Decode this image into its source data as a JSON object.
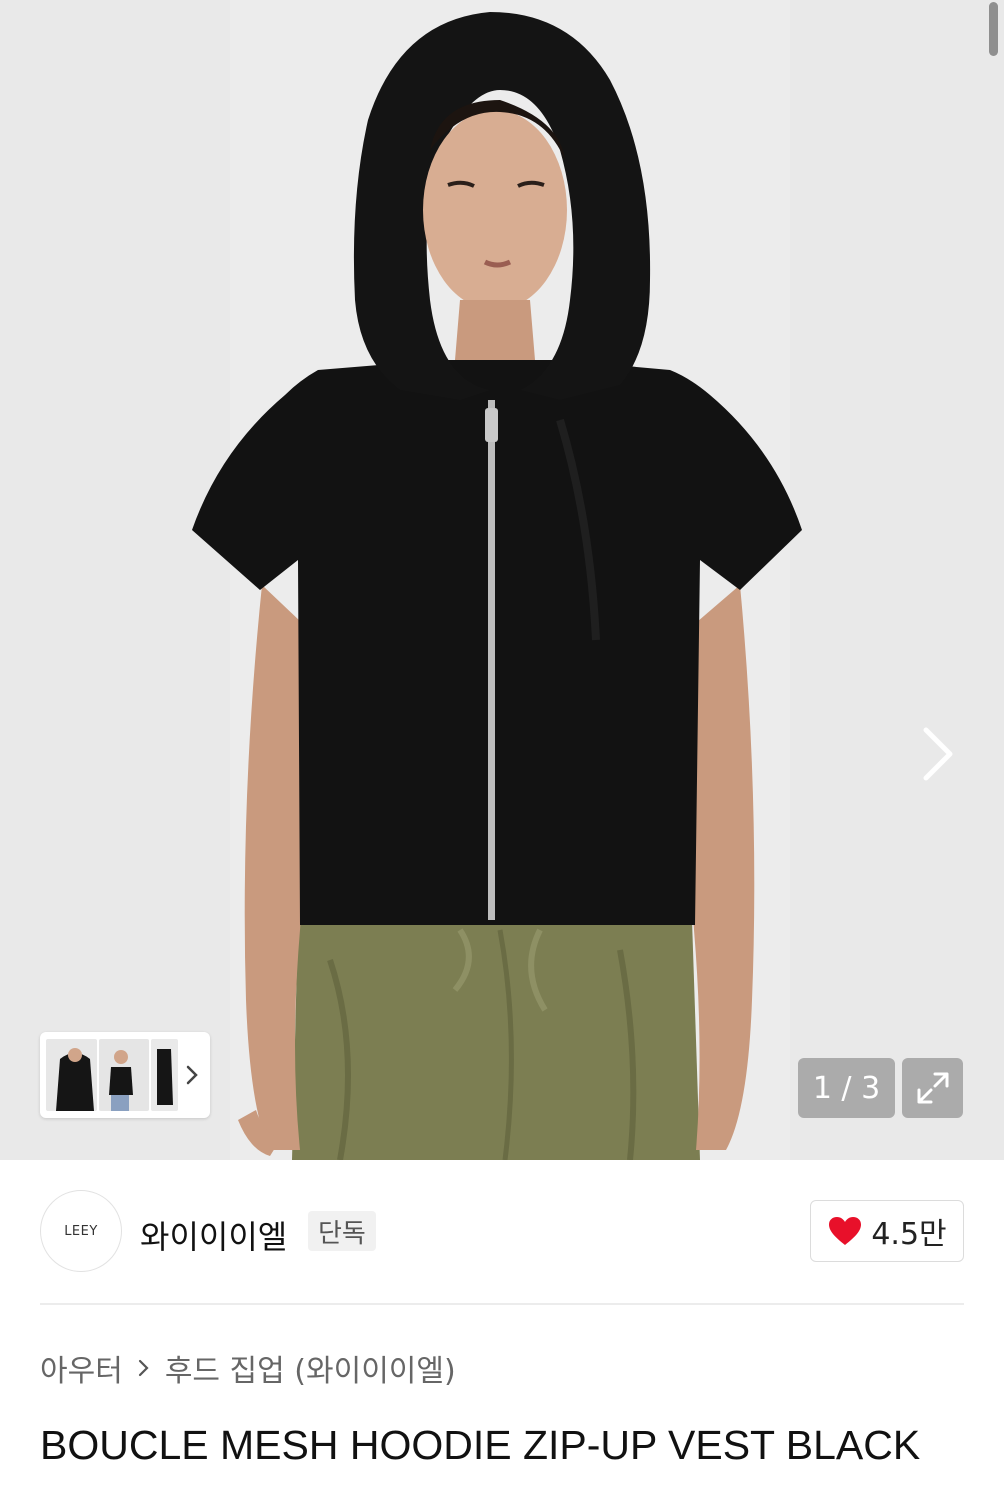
{
  "gallery": {
    "counter": "1 / 3",
    "thumbnails": [
      "thumbnail-1",
      "thumbnail-2",
      "thumbnail-3"
    ]
  },
  "brand": {
    "logo_text": "LEEY",
    "name": "와이이이엘",
    "badge": "단독",
    "like_count": "4.5만",
    "like_color": "#e8102a"
  },
  "breadcrumb": {
    "category": "아우터",
    "subcategory": "후드 집업 (와이이이엘)"
  },
  "product": {
    "title": "BOUCLE MESH HOODIE ZIP-UP VEST BLACK"
  }
}
